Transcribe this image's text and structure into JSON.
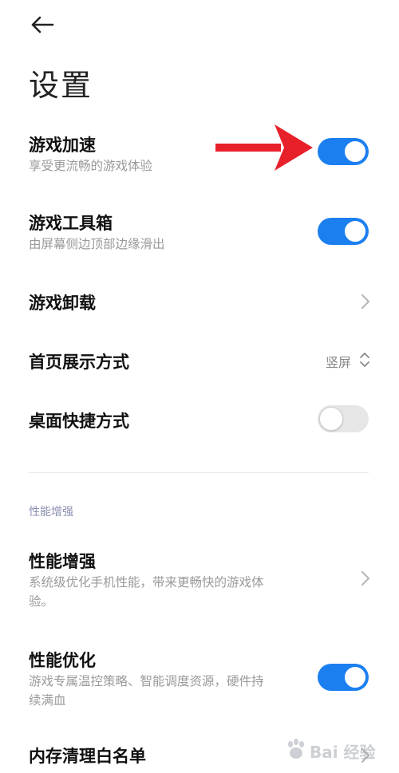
{
  "header": {
    "title": "设置",
    "back_icon": "arrow-left-icon"
  },
  "items": [
    {
      "title": "游戏加速",
      "subtitle": "享受更流畅的游戏体验",
      "control": "toggle",
      "on": true
    },
    {
      "title": "游戏工具箱",
      "subtitle": "由屏幕侧边顶部边缘滑出",
      "control": "toggle",
      "on": true
    },
    {
      "title": "游戏卸载",
      "control": "chevron"
    },
    {
      "title": "首页展示方式",
      "value": "竖屏",
      "control": "select"
    },
    {
      "title": "桌面快捷方式",
      "control": "toggle",
      "on": false
    }
  ],
  "section_header": "性能增强",
  "perf_items": [
    {
      "title": "性能增强",
      "subtitle_line1": "系统级优化手机性能，带来更畅快的游戏体",
      "subtitle_line2": "验。",
      "control": "chevron"
    },
    {
      "title": "性能优化",
      "subtitle_line1": "游戏专属温控策略、智能调度资源，硬件持",
      "subtitle_line2": "续满血",
      "control": "toggle",
      "on": true
    },
    {
      "title": "内存清理白名单",
      "control": "chevron"
    }
  ],
  "annotation": {
    "type": "red-arrow",
    "color": "#e8202a"
  },
  "watermark": {
    "text": "Bai 经验"
  },
  "colors": {
    "accent": "#1c7ff0",
    "subtitle": "#9a9a9a",
    "section": "#8a8fb0"
  }
}
